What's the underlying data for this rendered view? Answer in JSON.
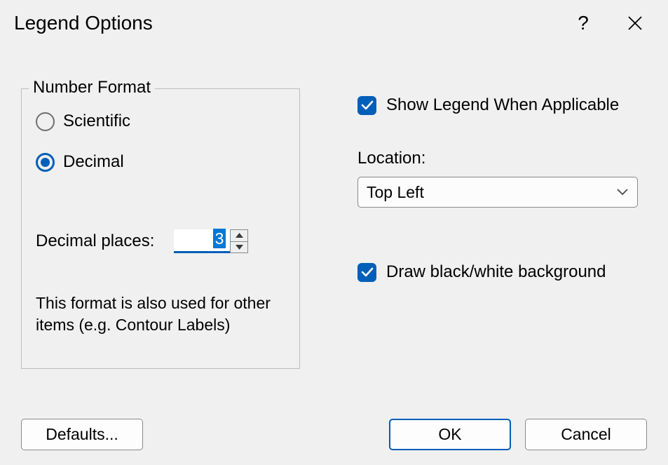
{
  "title": "Legend Options",
  "number_format": {
    "legend": "Number Format",
    "scientific_label": "Scientific",
    "decimal_label": "Decimal",
    "selected": "decimal",
    "decimal_places_label": "Decimal places:",
    "decimal_places_value": "3",
    "note": "This format is also used for other items (e.g. Contour Labels)"
  },
  "show_legend": {
    "label": "Show Legend When Applicable",
    "checked": true
  },
  "location": {
    "label": "Location:",
    "value": "Top Left"
  },
  "draw_bw_bg": {
    "label": "Draw black/white background",
    "checked": true
  },
  "buttons": {
    "defaults": "Defaults...",
    "ok": "OK",
    "cancel": "Cancel"
  },
  "colors": {
    "accent": "#005fb8"
  }
}
